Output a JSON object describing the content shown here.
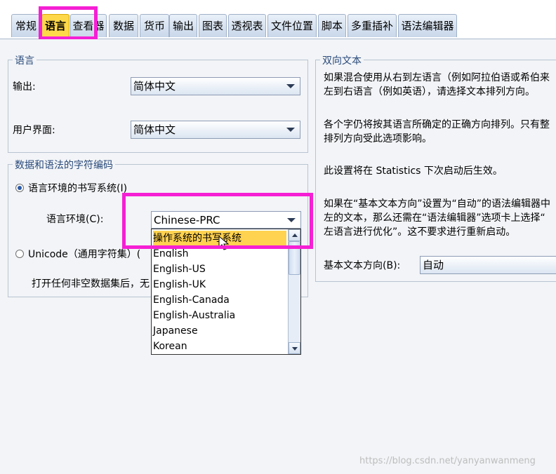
{
  "tabs": [
    "常规",
    "语言",
    "查看器",
    "数据",
    "货币",
    "输出",
    "图表",
    "透视表",
    "文件位置",
    "脚本",
    "多重插补",
    "语法编辑器"
  ],
  "language_group": {
    "title": "语言",
    "output_label": "输出:",
    "output_value": "简体中文",
    "ui_label": "用户界面:",
    "ui_value": "简体中文"
  },
  "encoding_group": {
    "title": "数据和语法的字符编码",
    "locale_radio_label": "语言环境的书写系统(I)",
    "locale_label": "语言环境(C):",
    "locale_value": "Chinese-PRC",
    "unicode_radio_label": "Unicode（通用字符集）(",
    "note": "打开任何非空数据集后，无"
  },
  "dropdown_options": [
    "操作系统的书写系统",
    "English",
    "English-US",
    "English-UK",
    "English-Canada",
    "English-Australia",
    "Japanese",
    "Korean"
  ],
  "bidi_group": {
    "title": "双向文本",
    "para1_line1": "如果混合使用从右到左语言（例如阿拉伯语或希伯来",
    "para1_line2": "左到右语言（例如英语），请选择文本排列方向。",
    "para2_line1": "各个字仍将按其语言所确定的正确方向排列。只有整",
    "para2_line2": "排列方向受此选项影响。",
    "para3": "此设置将在 Statistics 下次启动后生效。",
    "para4_line1": "如果在“基本文本方向”设置为“自动”的语法编辑器中",
    "para4_line2": "左的文本，那么还需在“语法编辑器”选项卡上选择“",
    "para4_line3": "左语言进行优化”。这不要求进行重新启动。",
    "base_dir_label": "基本文本方向(B):",
    "base_dir_value": "自动"
  },
  "watermark": "https://blog.csdn.net/yanyanwanmeng"
}
